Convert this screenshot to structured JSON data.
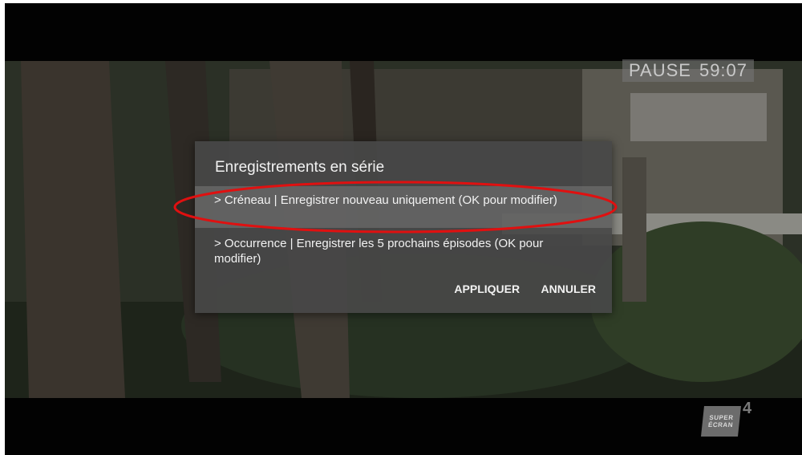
{
  "player": {
    "state": "PAUSE",
    "time": "59:07"
  },
  "dialog": {
    "title": "Enregistrements en série",
    "options": [
      {
        "label": "> Créneau | Enregistrer nouveau uniquement (OK pour modifier)",
        "selected": true
      },
      {
        "label": "> Occurrence | Enregistrer les 5 prochains épisodes (OK pour modifier)",
        "selected": false
      }
    ],
    "buttons": {
      "apply": "APPLIQUER",
      "cancel": "ANNULER"
    }
  },
  "channel_logo": {
    "line1": "SUPER",
    "line2": "ÉCRAN",
    "number": "4"
  },
  "colors": {
    "annotation_ellipse": "#e01010",
    "dialog_bg": "#484848"
  }
}
